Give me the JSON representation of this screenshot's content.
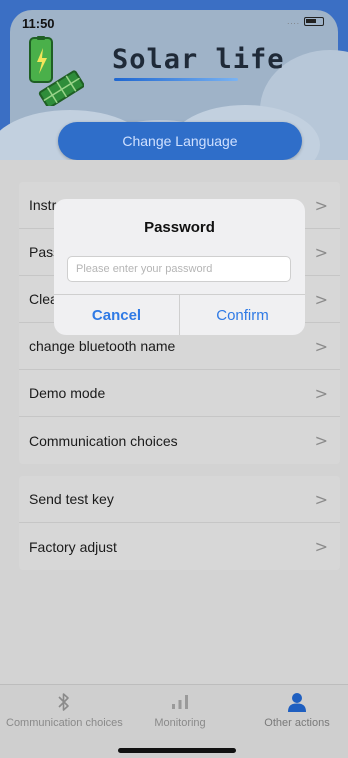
{
  "status": {
    "time": "11:50",
    "signal": "...."
  },
  "header": {
    "brand": "Solar life",
    "language_button": "Change Language"
  },
  "menu_group_1": [
    {
      "label": "Instr",
      "chevron": ">"
    },
    {
      "label": "Pass",
      "chevron": ">"
    },
    {
      "label": "Clea",
      "chevron": ">"
    },
    {
      "label": "change bluetooth name",
      "chevron": ">"
    },
    {
      "label": "Demo mode",
      "chevron": ">"
    },
    {
      "label": "Communication choices",
      "chevron": ">"
    }
  ],
  "menu_group_2": [
    {
      "label": "Send test key",
      "chevron": ">"
    },
    {
      "label": "Factory adjust",
      "chevron": ">"
    }
  ],
  "dialog": {
    "title": "Password",
    "input_value": "",
    "input_placeholder": "Please enter your password",
    "cancel": "Cancel",
    "confirm": "Confirm"
  },
  "tabbar": {
    "tabs": [
      {
        "label": "Communication choices",
        "icon": "bluetooth-icon"
      },
      {
        "label": "Monitoring",
        "icon": "bar-chart-icon"
      },
      {
        "label": "Other actions",
        "icon": "person-icon",
        "active": true
      }
    ]
  },
  "colors": {
    "accent": "#2f6ec9",
    "dialog_button": "#2f7ae5",
    "active_tab_icon": "#1f5fc0"
  }
}
